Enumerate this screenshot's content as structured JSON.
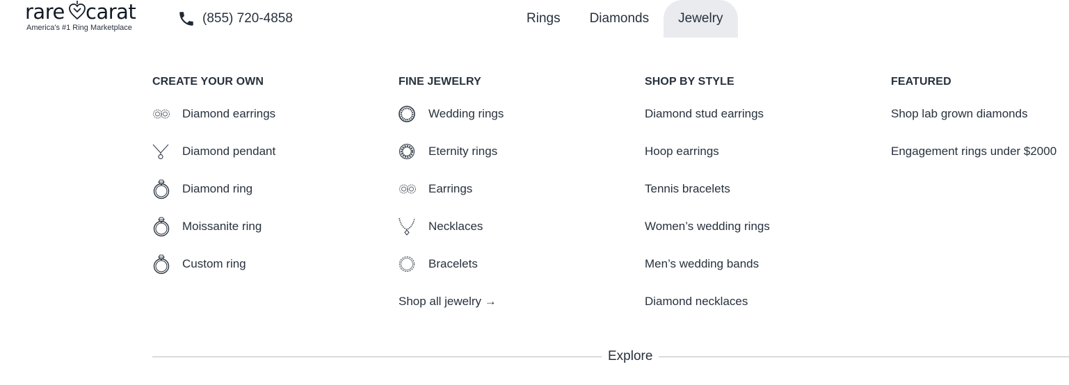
{
  "brand": {
    "word_left": "rare",
    "word_right": "carat",
    "tagline": "America's #1 Ring Marketplace"
  },
  "phone": {
    "number": "(855) 720-4858",
    "icon": "phone-icon"
  },
  "nav": [
    {
      "label": "Rings",
      "active": false
    },
    {
      "label": "Diamonds",
      "active": false
    },
    {
      "label": "Jewelry",
      "active": true
    }
  ],
  "menu": {
    "create": {
      "heading": "CREATE YOUR OWN",
      "items": [
        {
          "label": "Diamond earrings",
          "icon": "earrings-icon"
        },
        {
          "label": "Diamond pendant",
          "icon": "pendant-icon"
        },
        {
          "label": "Diamond ring",
          "icon": "ring-icon"
        },
        {
          "label": "Moissanite ring",
          "icon": "ring-icon"
        },
        {
          "label": "Custom ring",
          "icon": "ring-icon"
        }
      ]
    },
    "fine": {
      "heading": "FINE JEWELRY",
      "items": [
        {
          "label": "Wedding rings",
          "icon": "wedding-ring-icon"
        },
        {
          "label": "Eternity rings",
          "icon": "eternity-ring-icon"
        },
        {
          "label": "Earrings",
          "icon": "earrings-icon"
        },
        {
          "label": "Necklaces",
          "icon": "necklace-icon"
        },
        {
          "label": "Bracelets",
          "icon": "bracelet-icon"
        }
      ],
      "shop_all": "Shop all jewelry →"
    },
    "style": {
      "heading": "SHOP BY STYLE",
      "items": [
        "Diamond stud earrings",
        "Hoop earrings",
        "Tennis bracelets",
        "Women’s wedding rings",
        "Men’s wedding bands",
        "Diamond necklaces"
      ]
    },
    "featured": {
      "heading": "FEATURED",
      "items": [
        "Shop lab grown diamonds",
        "Engagement rings under $2000"
      ]
    }
  },
  "explore": {
    "label": "Explore"
  },
  "colors": {
    "text": "#27313d",
    "active_tab_bg": "#e9ebee",
    "divider": "#b8bcc2"
  }
}
